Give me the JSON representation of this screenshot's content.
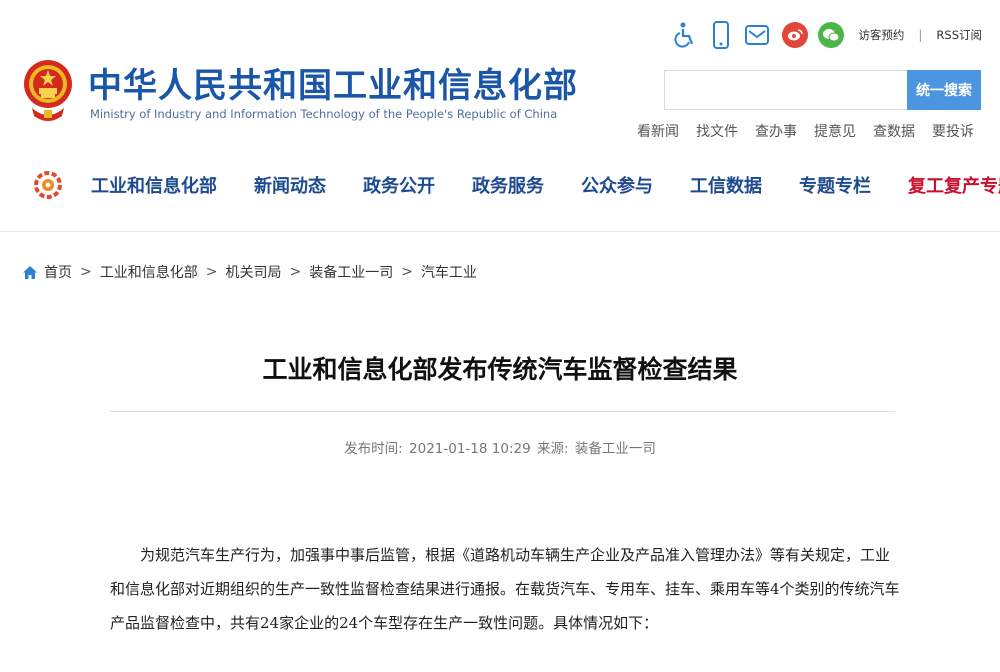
{
  "header": {
    "site_title": "中华人民共和国工业和信息化部",
    "site_subtitle": "Ministry of Industry and Information Technology of the People's Republic of China",
    "toolbar": {
      "icons": [
        "accessibility-icon",
        "mobile-icon",
        "mail-icon",
        "weibo-icon",
        "wechat-icon"
      ],
      "visitor_booking": "访客预约",
      "separator": "|",
      "rss": "RSS订阅"
    },
    "search": {
      "placeholder": "",
      "button_label": "统一搜索"
    },
    "quick_links": [
      "看新闻",
      "找文件",
      "查办事",
      "提意见",
      "查数据",
      "要投诉"
    ]
  },
  "nav": {
    "items": [
      "工业和信息化部",
      "新闻动态",
      "政务公开",
      "政务服务",
      "公众参与",
      "工信数据",
      "专题专栏"
    ],
    "special": "复工复产专题",
    "special_color": "#c8102e",
    "accent": "#1e4b8f"
  },
  "breadcrumb": {
    "items": [
      "首页",
      "工业和信息化部",
      "机关司局",
      "装备工业一司",
      "汽车工业"
    ],
    "separator": ">"
  },
  "article": {
    "title": "工业和信息化部发布传统汽车监督检查结果",
    "meta": {
      "published_label": "发布时间:",
      "published_value": "2021-01-18 10:29",
      "source_label": "来源:",
      "source_value": "装备工业一司"
    },
    "paragraph": "为规范汽车生产行为，加强事中事后监管，根据《道路机动车辆生产企业及产品准入管理办法》等有关规定，工业和信息化部对近期组织的生产一致性监督检查结果进行通报。在载货汽车、专用车、挂车、乘用车等4个类别的传统汽车产品监督检查中，共有24家企业的24个车型存在生产一致性问题。具体情况如下："
  }
}
